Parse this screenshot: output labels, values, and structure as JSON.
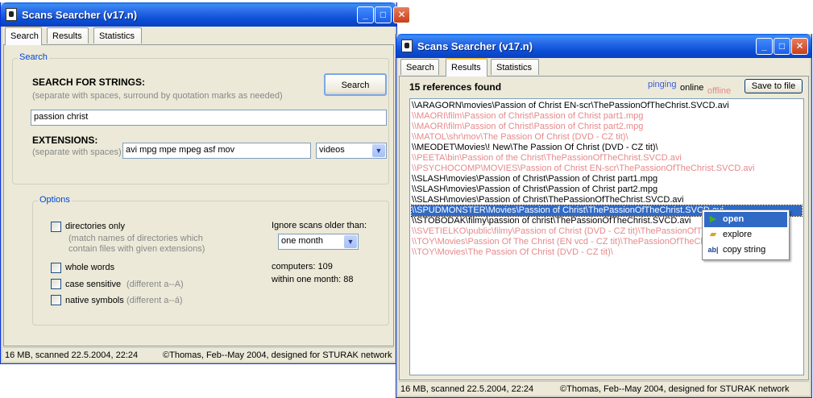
{
  "window1": {
    "title": "Scans Searcher (v17.n)",
    "tabs": [
      "Search",
      "Results",
      "Statistics"
    ],
    "search_group_label": "Search",
    "search_for_strings_label": "SEARCH FOR STRINGS:",
    "strings_hint": "(separate with spaces, surround by quotation marks as needed)",
    "search_input_value": "passion christ",
    "search_button": "Search",
    "extensions_label": "EXTENSIONS:",
    "extensions_hint": "(separate with spaces)",
    "extensions_value": "avi mpg mpe mpeg asf mov",
    "extensions_preset": "videos",
    "options_label": "Options",
    "opt_directories": "directories only",
    "opt_directories_hint1": "(match names of directories which",
    "opt_directories_hint2": "contain files with given extensions)",
    "opt_whole_words": "whole words",
    "opt_case_sensitive": "case sensitive",
    "opt_case_hint": "(different a--A)",
    "opt_native": "native symbols",
    "opt_native_hint": "(different a--á)",
    "ignore_scans_label": "Ignore scans older than:",
    "ignore_scans_value": "one month",
    "computers_text": "computers: 109",
    "within_month_text": "within one month: 88",
    "status_left": "16 MB, scanned 22.5.2004, 22:24",
    "status_right": "©Thomas,  Feb--May 2004,  designed for STURAK network"
  },
  "window2": {
    "title": "Scans Searcher (v17.n)",
    "tabs": [
      "Search",
      "Results",
      "Statistics"
    ],
    "references_found": "15 references found",
    "pinging": "pinging",
    "online": "online",
    "offline": "offline",
    "save_button": "Save to file",
    "results": [
      {
        "text": "\\\\ARAGORN\\movies\\Passion of Christ EN-scr\\ThePassionOfTheChrist.SVCD.avi",
        "state": "on"
      },
      {
        "text": "\\\\MAORI\\film\\Passion of Christ\\Passion of Christ part1.mpg",
        "state": "off"
      },
      {
        "text": "\\\\MAORI\\film\\Passion of Christ\\Passion of Christ part2.mpg",
        "state": "off"
      },
      {
        "text": "\\\\MATOL\\shr\\mov\\The Passion Of Christ  (DVD - CZ tit)\\",
        "state": "off"
      },
      {
        "text": "\\\\MEODET\\Movies\\! New\\The Passion Of Christ  (DVD - CZ tit)\\",
        "state": "on"
      },
      {
        "text": "\\\\PEETA\\bin\\Passion of the Christ\\ThePassionOfTheChrist.SVCD.avi",
        "state": "off"
      },
      {
        "text": "\\\\PSYCHOCOMP\\MOVIES\\Passion of Christ EN-scr\\ThePassionOfTheChrist.SVCD.avi",
        "state": "off"
      },
      {
        "text": "\\\\SLASH\\movies\\Passion of Christ\\Passion of Christ part1.mpg",
        "state": "on"
      },
      {
        "text": "\\\\SLASH\\movies\\Passion of Christ\\Passion of Christ part2.mpg",
        "state": "on"
      },
      {
        "text": "\\\\SLASH\\movies\\Passion of Christ\\ThePassionOfTheChrist.SVCD.avi",
        "state": "on"
      },
      {
        "text": "\\\\SPUDMONSTER\\Movies\\Passion of Christ\\ThePassionOfTheChrist.SVCD.avi",
        "state": "sel"
      },
      {
        "text": "\\\\STOBODAK\\filmy\\passion of christ\\ThePassionOfTheChrist.SVCD.avi",
        "state": "on"
      },
      {
        "text": "\\\\SVETIELKO\\public\\filmy\\Passion of Christ (DVD - CZ tit)\\ThePassionOfTheChrist.SVCD.avi",
        "state": "off"
      },
      {
        "text": "\\\\TOY\\Movies\\Passion Of The Christ (EN vcd - CZ tit)\\ThePassionOfTheChrist.SVCD.avi",
        "state": "off"
      },
      {
        "text": "\\\\TOY\\Movies\\The Passion Of Christ  (DVD - CZ tit)\\",
        "state": "off"
      }
    ],
    "context_menu": [
      "open",
      "explore",
      "copy string"
    ],
    "status_left": "16 MB, scanned 22.5.2004, 22:24",
    "status_right": "©Thomas,  Feb--May 2004,  designed for STURAK network"
  },
  "colors": {
    "titlebar": "#0a4fd6",
    "online": "#000000",
    "offline": "#e6898b",
    "pinging": "#3b5bdb",
    "selection": "#316ac5",
    "group_label": "#0046d5"
  }
}
